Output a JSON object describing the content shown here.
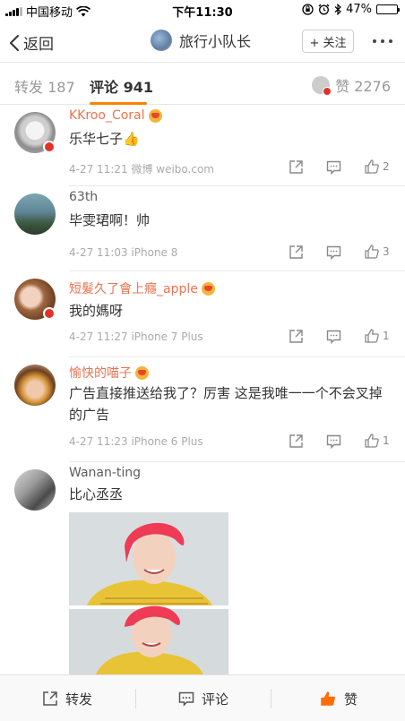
{
  "status_bar": {
    "carrier": "中国移动",
    "time": "下午11:30",
    "battery": "47%",
    "battery_level": 0.47
  },
  "nav": {
    "back_label": "返回",
    "title": "旅行小队长",
    "follow_label": "+ 关注"
  },
  "tabs": {
    "repost": "转发 187",
    "comments": "评论 941",
    "likes": "赞 2276"
  },
  "comments": [
    {
      "name": "KKroo_Coral",
      "text": "乐华七子👍",
      "meta": "4-27 11:21  微博 weibo.com",
      "likes": "2"
    },
    {
      "name": "63th",
      "text": "毕雯珺啊！帅",
      "meta": "4-27 11:03  iPhone 8",
      "likes": "3"
    },
    {
      "name": "短髮久了會上癮_apple",
      "text": "我的媽呀",
      "meta": "4-27 11:27  iPhone 7 Plus",
      "likes": "1"
    },
    {
      "name": "愉快的喵子",
      "text": "广告直接推送给我了？厉害 这是我唯一一个不会叉掉的广告",
      "meta": "4-27 11:23  iPhone 6 Plus",
      "likes": "1"
    },
    {
      "name": "Wanan-ting",
      "text": "比心丞丞"
    }
  ],
  "bottom_bar": {
    "repost": "转发",
    "comment": "评论",
    "like": "赞"
  },
  "colors": {
    "accent_orange": "#ff8200",
    "vip_name": "#eb7350",
    "like_active": "#ff6c00"
  }
}
